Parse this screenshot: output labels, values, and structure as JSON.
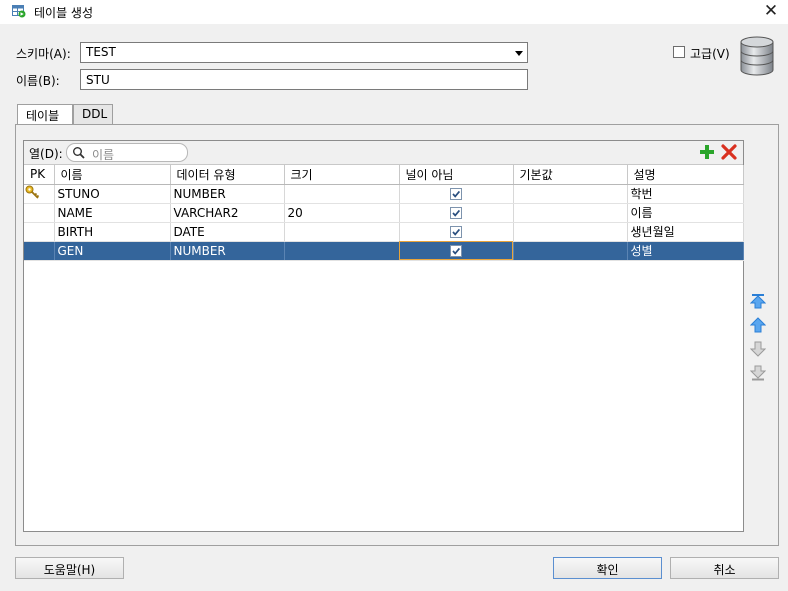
{
  "window": {
    "title": "테이블 생성",
    "close_label": "✕"
  },
  "schema": {
    "label": "스키마(A):",
    "value": "TEST"
  },
  "name": {
    "label": "이름(B):",
    "value": "STU"
  },
  "advanced": {
    "label": "고급(V)",
    "checked": false
  },
  "tabs": [
    {
      "label": "테이블",
      "active": true
    },
    {
      "label": "DDL",
      "active": false
    }
  ],
  "columns_filter": {
    "label": "열(D):",
    "placeholder": "이름"
  },
  "table": {
    "headers": [
      "PK",
      "이름",
      "데이터 유형",
      "크기",
      "널이 아님",
      "기본값",
      "설명"
    ],
    "rows": [
      {
        "pk": true,
        "name": "STUNO",
        "type": "NUMBER",
        "size": "",
        "not_null": true,
        "default": "",
        "comment": "학번",
        "selected": false
      },
      {
        "pk": false,
        "name": "NAME",
        "type": "VARCHAR2",
        "size": "20",
        "not_null": true,
        "default": "",
        "comment": "이름",
        "selected": false
      },
      {
        "pk": false,
        "name": "BIRTH",
        "type": "DATE",
        "size": "",
        "not_null": true,
        "default": "",
        "comment": "생년월일",
        "selected": false
      },
      {
        "pk": false,
        "name": "GEN",
        "type": "NUMBER",
        "size": "",
        "not_null": true,
        "default": "",
        "comment": "성별",
        "selected": true
      }
    ]
  },
  "buttons": {
    "help": "도움말(H)",
    "ok": "확인",
    "cancel": "취소"
  },
  "colors": {
    "selection": "#34659b",
    "add": "#2aa52a",
    "delete": "#d9301f",
    "arrow": "#2b7fd6"
  }
}
